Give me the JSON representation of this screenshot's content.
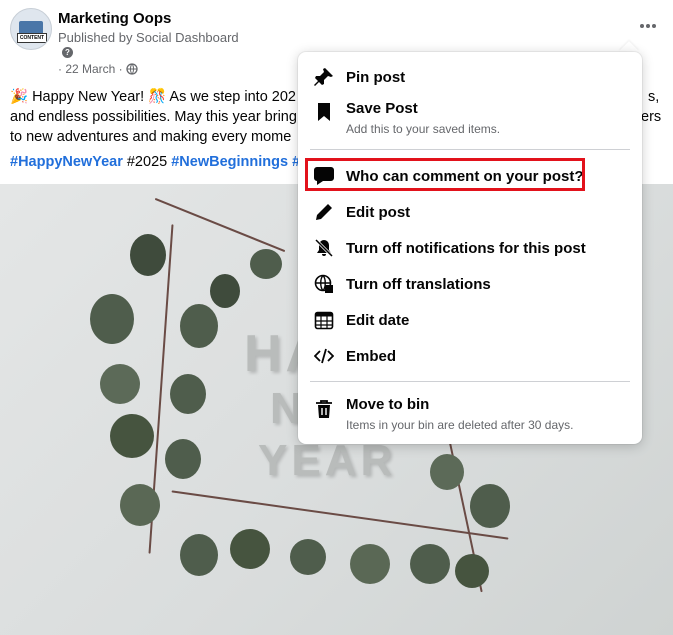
{
  "post": {
    "page_name": "Marketing Oops",
    "published_by": "Published by Social Dashboard",
    "help_mark": "?",
    "meta": "· 22 March ·",
    "avatar_text": "CONTENT",
    "text_lines": [
      "🎉 Happy New Year! 🎊 As we step into 202",
      "and endless possibilities. May this year bring",
      "to new adventures and making every mome"
    ],
    "text_right_fragments": [
      "s,",
      "ers"
    ],
    "hashtags": [
      {
        "text": "#HappyNewYear",
        "link": true
      },
      {
        "text": " #2025 ",
        "link": false
      },
      {
        "text": "#NewBeginnings",
        "link": true
      },
      {
        "text": " #",
        "link": true
      }
    ],
    "photo_text": [
      "HA",
      "N",
      "YEAR"
    ]
  },
  "menu": {
    "items": [
      {
        "label": "Pin post",
        "icon": "pin-icon"
      },
      {
        "label": "Save Post",
        "sub": "Add this to your saved items.",
        "icon": "bookmark-icon"
      },
      {
        "label": "Who can comment on your post?",
        "icon": "comment-icon",
        "highlighted": true
      },
      {
        "label": "Edit post",
        "icon": "pencil-icon"
      },
      {
        "label": "Turn off notifications for this post",
        "icon": "bell-off-icon"
      },
      {
        "label": "Turn off translations",
        "icon": "globe-translate-icon"
      },
      {
        "label": "Edit date",
        "icon": "calendar-icon"
      },
      {
        "label": "Embed",
        "icon": "code-icon"
      },
      {
        "label": "Move to bin",
        "sub": "Items in your bin are deleted after 30 days.",
        "icon": "trash-icon"
      }
    ]
  },
  "colors": {
    "link": "#216fdb",
    "highlight_border": "#e2121b",
    "secondary_text": "#65676b"
  }
}
